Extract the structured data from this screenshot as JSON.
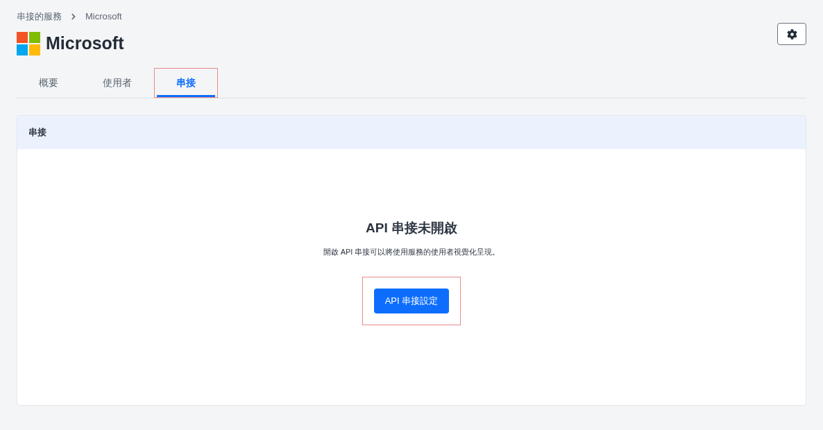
{
  "breadcrumb": [
    "串接的服務",
    "Microsoft"
  ],
  "title": "Microsoft",
  "tabs": [
    {
      "label": "概要",
      "selected": false,
      "highlighted": false
    },
    {
      "label": "使用者",
      "selected": false,
      "highlighted": false
    },
    {
      "label": "串接",
      "selected": true,
      "highlighted": true
    }
  ],
  "panel": {
    "header": "串接",
    "empty_title": "API 串接未開啟",
    "empty_text": "開啟 API 串接可以將使用服務的使用者視覺化呈現。",
    "button": {
      "label": "API 串接設定",
      "highlighted": true
    }
  }
}
